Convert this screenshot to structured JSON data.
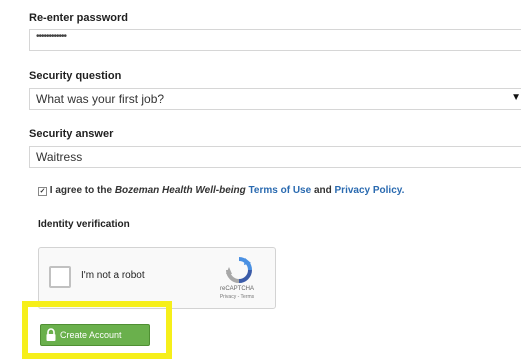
{
  "reenter_password": {
    "label": "Re-enter password",
    "value": "••••••••••••"
  },
  "security_question": {
    "label": "Security question",
    "selected": "What was your first job?",
    "arrow_icon": "dropdown-arrow-icon"
  },
  "security_answer": {
    "label": "Security answer",
    "value": "Waitress"
  },
  "agreement": {
    "checked": true,
    "check_glyph": "✓",
    "prefix": "I agree to the",
    "brand": "Bozeman Health Well-being",
    "terms_link": "Terms of Use",
    "and": "and",
    "privacy_link": "Privacy Policy."
  },
  "identity": {
    "label": "Identity verification"
  },
  "recaptcha": {
    "checkbox_label": "I'm not a robot",
    "brand": "reCAPTCHA",
    "links": "Privacy - Terms",
    "logo_icon": "recaptcha-logo-icon"
  },
  "create_account": {
    "label": "Create Account",
    "icon": "lock-icon",
    "highlight_color": "#f6ef1a",
    "button_color": "#6ab04c"
  }
}
